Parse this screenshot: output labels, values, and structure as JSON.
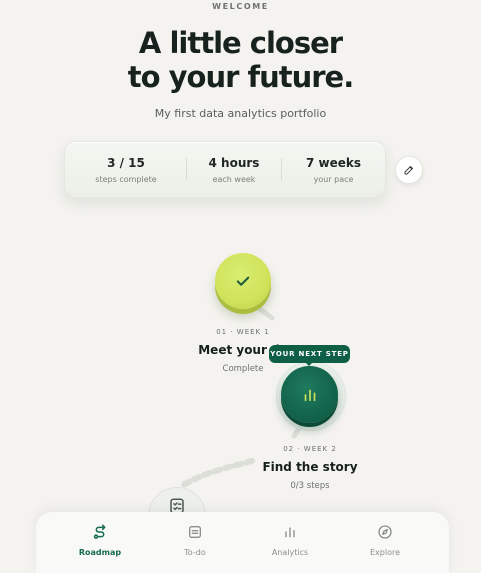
{
  "header": {
    "eyebrow": "WELCOME",
    "title_line1": "A little closer",
    "title_line2": "to your future.",
    "subtitle": "My first data analytics portfolio"
  },
  "stats": [
    {
      "value": "3 / 15",
      "label": "steps complete"
    },
    {
      "value": "4 hours",
      "label": "each week"
    },
    {
      "value": "7 weeks",
      "label": "your pace"
    }
  ],
  "edit": {
    "icon": "pencil-icon"
  },
  "roadmap": {
    "step1": {
      "meta": "01 · WEEK 1",
      "title": "Meet your da",
      "status": "Complete",
      "icon": "check-icon"
    },
    "next_badge": "YOUR NEXT STEP",
    "step2": {
      "meta": "02 · WEEK 2",
      "title": "Find the story",
      "status": "0/3 steps",
      "icon": "bar-chart-icon"
    },
    "step3": {
      "icon": "checklist-icon"
    }
  },
  "nav": [
    {
      "label": "Roadmap",
      "icon": "route-icon",
      "active": true
    },
    {
      "label": "To-do",
      "icon": "todo-icon",
      "active": false
    },
    {
      "label": "Analytics",
      "icon": "bar-chart-icon",
      "active": false
    },
    {
      "label": "Explore",
      "icon": "compass-icon",
      "active": false
    }
  ],
  "colors": {
    "background": "#f4f3ef",
    "accent_green": "#12624a",
    "lime": "#cfe35a"
  }
}
